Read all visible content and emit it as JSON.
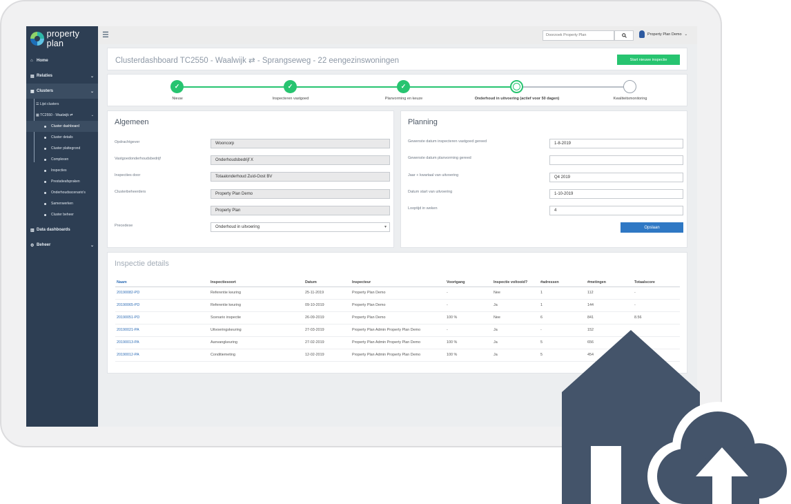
{
  "brand": {
    "name": "property plan"
  },
  "sidebar": {
    "items": [
      {
        "label": "Home",
        "icon": "home-icon"
      },
      {
        "label": "Relaties",
        "icon": "address-card-icon"
      },
      {
        "label": "Clusters",
        "icon": "cluster-icon"
      }
    ],
    "clusters_sub": [
      {
        "label": "Lijst clusters"
      },
      {
        "label": "TC2550 - Waalwijk ⇄"
      }
    ],
    "cluster_pages": [
      "Cluster dashboard",
      "Cluster details",
      "Cluster plattegrond",
      "Complexen",
      "Inspecties",
      "Prestatieafspraken",
      "Onderhoudsscenario's",
      "Samenwerken",
      "Cluster beheer"
    ],
    "bottom_items": [
      {
        "label": "Data dashboards",
        "icon": "chart-icon"
      },
      {
        "label": "Beheer",
        "icon": "gear-icon"
      }
    ]
  },
  "topbar": {
    "search_placeholder": "Doorzoek Property Plan",
    "user_name": "Property Plan Demo"
  },
  "header": {
    "title": "Clusterdashboard  TC2550 - Waalwijk ⇄ - Sprangseweg - 22 eengezinswoningen",
    "new_inspection_button": "Start nieuwe inspectie"
  },
  "steps": [
    {
      "label": "Nieuw",
      "state": "done"
    },
    {
      "label": "Inspecteren vastgoed",
      "state": "done"
    },
    {
      "label": "Planvorming en keuze",
      "state": "done"
    },
    {
      "label": "Onderhoud in uitvoering (actief voor 50 dagen)",
      "state": "current"
    },
    {
      "label": "Kwaliteitsmonitoring",
      "state": "todo"
    }
  ],
  "algemeen": {
    "title": "Algemeen",
    "fields": [
      {
        "label": "Opdrachtgever",
        "value": "Wooncorp"
      },
      {
        "label": "Vastgoedonderhoudsbedrijf",
        "value": "Onderhoudsbedrijf X"
      },
      {
        "label": "Inspecties door",
        "value": "Totaalonderhoud Zuid-Oost BV"
      },
      {
        "label": "Clusterbeheerders",
        "value": "Property Plan Demo"
      },
      {
        "label": "",
        "value": "Property Plan"
      }
    ],
    "precedence_label": "Precedese",
    "precedence_value": "Onderhoud in uitvoering"
  },
  "planning": {
    "title": "Planning",
    "fields": [
      {
        "label": "Gewenste datum inspecteren vastgoed gereed",
        "value": "1-8-2019"
      },
      {
        "label": "Gewenste datum planvorming gereed",
        "value": ""
      },
      {
        "label": "Jaar + kwartaal van uitvoering",
        "value": "Q4 2019"
      },
      {
        "label": "Datum start van uitvoering",
        "value": "1-10-2019"
      },
      {
        "label": "Looptijd in weken",
        "value": "4"
      }
    ],
    "save_button": "Opslaan"
  },
  "details": {
    "title": "Inspectie details",
    "columns": [
      "Naam",
      "Inspectiesoort",
      "Datum",
      "Inspecteur",
      "Voortgang",
      "Inspectie voltooid?",
      "#adressen",
      "#metingen",
      "Totaalscore"
    ],
    "rows": [
      [
        "20190082-PD",
        "Referentie keuring",
        "25-11-2019",
        "Property Plan Demo",
        "-",
        "Nee",
        "1",
        "112",
        "-"
      ],
      [
        "20190065-PD",
        "Referentie keuring",
        "09-10-2019",
        "Property Plan Demo",
        "-",
        "Ja",
        "1",
        "144",
        "-"
      ],
      [
        "20190051-PD",
        "Scenario inspectie",
        "26-09-2019",
        "Property Plan Demo",
        "100 %",
        "Nee",
        "6",
        "841",
        "8.56"
      ],
      [
        "20190021-PA",
        "Uitvoeringskeuring",
        "27-03-2019",
        "Property Plan Admin Property Plan Demo",
        "-",
        "Ja",
        "-",
        "152",
        ""
      ],
      [
        "20190013-PA",
        "Aanvangkeuring",
        "27-02-2019",
        "Property Plan Admin Property Plan Demo",
        "100 %",
        "Ja",
        "5",
        "656",
        ""
      ],
      [
        "20190012-PA",
        "Conditiemeting",
        "12-02-2019",
        "Property Plan Admin Property Plan Demo",
        "100 %",
        "Ja",
        "5",
        "454",
        ""
      ]
    ]
  },
  "colors": {
    "sidebar": "#2d3e53",
    "accent_green": "#27c470",
    "accent_blue": "#2f78c4",
    "overlay": "#44546a"
  }
}
